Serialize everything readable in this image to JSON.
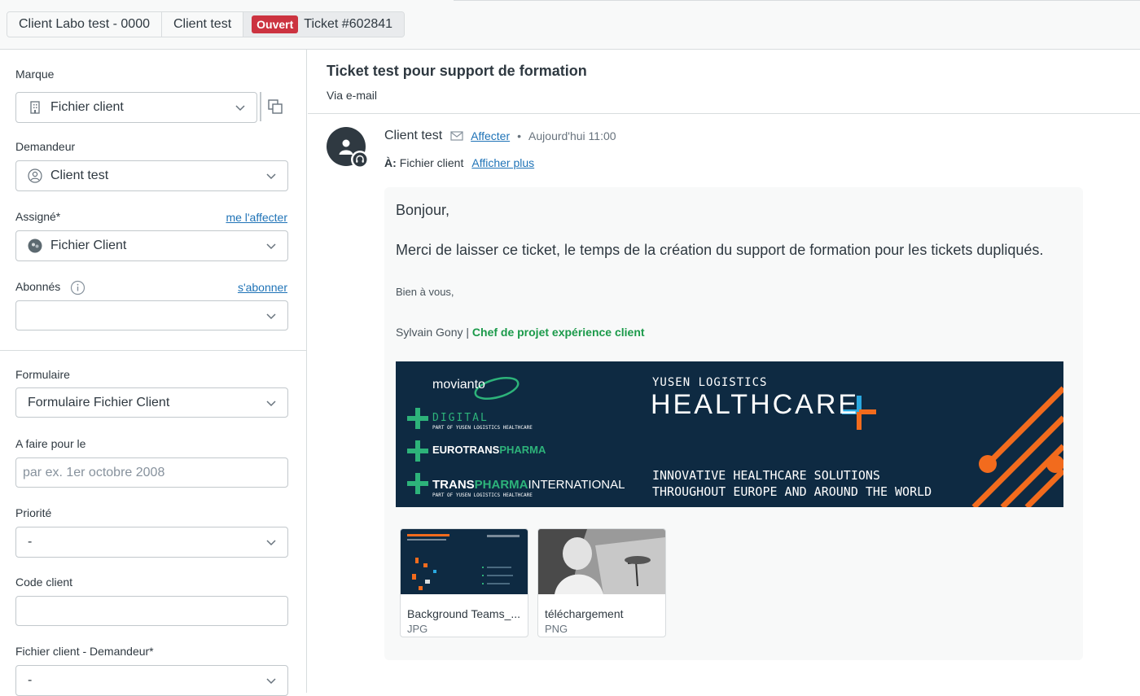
{
  "breadcrumb": {
    "org": "Client Labo test - 0000",
    "requester": "Client test",
    "status": "Ouvert",
    "ticket": "Ticket #602841"
  },
  "sidebar": {
    "brand": {
      "label": "Marque",
      "value": "Fichier client"
    },
    "requester": {
      "label": "Demandeur",
      "value": "Client test"
    },
    "assignee": {
      "label": "Assigné*",
      "link": "me l'affecter",
      "value": "Fichier Client"
    },
    "followers": {
      "label": "Abonnés",
      "link": "s'abonner",
      "value": ""
    },
    "form": {
      "label": "Formulaire",
      "value": "Formulaire Fichier Client"
    },
    "due_date": {
      "label": "A faire pour le",
      "placeholder": "par ex. 1er octobre 2008"
    },
    "priority": {
      "label": "Priorité",
      "value": "-"
    },
    "client_code": {
      "label": "Code client",
      "value": ""
    },
    "client_file_requester": {
      "label": "Fichier client - Demandeur*",
      "value": "-"
    }
  },
  "ticket": {
    "title": "Ticket test pour support de formation",
    "via": "Via e-mail"
  },
  "comment": {
    "author": "Client test",
    "assign_link": "Affecter",
    "separator": "•",
    "time": "Aujourd'hui 11:00",
    "to_label": "À:",
    "to_value": "Fichier client",
    "show_more": "Afficher plus",
    "greeting": "Bonjour,",
    "body": "Merci de laisser ce ticket, le temps de la création du support de formation pour les tickets dupliqués.",
    "signoff": "Bien à vous,",
    "signature_name": "Sylvain Gony | ",
    "signature_role": "Chef de projet expérience client",
    "banner": {
      "movianto": "movianto",
      "digital": "DIGITAL",
      "digital_sub": "PART OF YUSEN LOGISTICS HEALTHCARE",
      "euro_a": "EUROTRANS",
      "euro_b": "PHARMA",
      "trans_a": "TRANS",
      "trans_b": "PHARMA",
      "trans_c": "INTERNATIONAL",
      "trans_sub": "PART OF YUSEN LOGISTICS HEALTHCARE",
      "yusen": "YUSEN LOGISTICS",
      "healthcare": "HEALTHCARE",
      "tagline1": "INNOVATIVE HEALTHCARE SOLUTIONS",
      "tagline2": "THROUGHOUT EUROPE AND AROUND THE WORLD"
    },
    "attachments": [
      {
        "name": "Background Teams_...",
        "type": "JPG"
      },
      {
        "name": "téléchargement",
        "type": "PNG"
      }
    ]
  },
  "colors": {
    "status_open": "#cc3340",
    "link": "#1f73b7",
    "signature_role": "#1b9a4a",
    "banner_bg": "#0e2a42",
    "banner_orange": "#f26b1d",
    "banner_green": "#2db37a"
  }
}
